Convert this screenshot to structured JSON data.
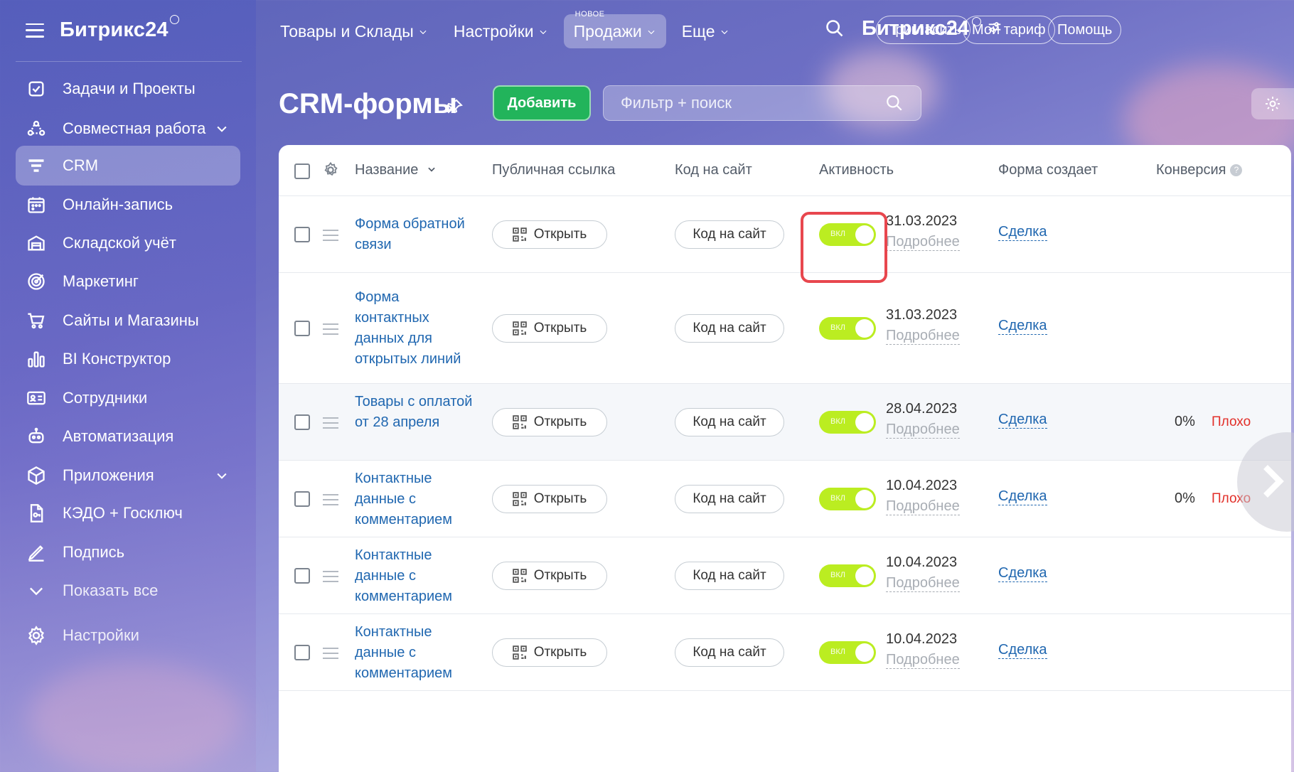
{
  "sidebar": {
    "logo": "Битрикс24",
    "items": [
      {
        "label": "Задачи и Проекты",
        "icon": "task-checkbox-icon"
      },
      {
        "label": "Совместная работа",
        "icon": "collaboration-icon",
        "expandable": true
      },
      {
        "label": "CRM",
        "icon": "crm-filter-icon",
        "active": true
      },
      {
        "label": "Онлайн-запись",
        "icon": "calendar-icon"
      },
      {
        "label": "Складской учёт",
        "icon": "warehouse-icon"
      },
      {
        "label": "Маркетинг",
        "icon": "target-icon"
      },
      {
        "label": "Сайты и Магазины",
        "icon": "cart-icon"
      },
      {
        "label": "BI Конструктор",
        "icon": "bar-chart-icon"
      },
      {
        "label": "Сотрудники",
        "icon": "id-card-icon"
      },
      {
        "label": "Автоматизация",
        "icon": "robot-icon"
      },
      {
        "label": "Приложения",
        "icon": "cube-icon",
        "expandable": true
      },
      {
        "label": "КЭДО + Госключ",
        "icon": "document-key-icon"
      },
      {
        "label": "Подпись",
        "icon": "signature-pen-icon"
      },
      {
        "label": "Показать все",
        "icon": "chevron-down-icon"
      },
      {
        "label": "Настройки",
        "icon": "gear-icon"
      }
    ]
  },
  "topnav": {
    "items": [
      {
        "label": "Товары и Склады"
      },
      {
        "label": "Настройки"
      },
      {
        "label": "Продажи",
        "badge": "НОВОЕ",
        "active": true
      },
      {
        "label": "Еще"
      }
    ],
    "logo": "Битрикс24",
    "invite": "Пригласить",
    "tariff": "Мой тариф",
    "help": "Помощь"
  },
  "page": {
    "title": "CRM-формы",
    "add_button": "Добавить",
    "filter_placeholder": "Фильтр + поиск"
  },
  "table": {
    "columns": [
      "Название",
      "Публичная ссылка",
      "Код на сайт",
      "Активность",
      "Форма создает",
      "Конверсия"
    ],
    "open_label": "Открыть",
    "code_label": "Код на сайт",
    "toggle_label": "ВКЛ",
    "more_label": "Подробнее",
    "rows": [
      {
        "name": "Форма обратной связи",
        "date": "31.03.2023",
        "creates": "Сделка",
        "conversion": "",
        "quality": ""
      },
      {
        "name": "Форма контактных данных для открытых линий",
        "date": "31.03.2023",
        "creates": "Сделка",
        "conversion": "",
        "quality": ""
      },
      {
        "name": "Товары с оплатой от 28 апреля",
        "date": "28.04.2023",
        "creates": "Сделка",
        "conversion": "0%",
        "quality": "Плохо"
      },
      {
        "name": "Контактные данные с комментарием",
        "date": "10.04.2023",
        "creates": "Сделка",
        "conversion": "0%",
        "quality": "Плохо"
      },
      {
        "name": "Контактные данные с комментарием",
        "date": "10.04.2023",
        "creates": "Сделка",
        "conversion": "",
        "quality": ""
      },
      {
        "name": "Контактные данные с комментарием",
        "date": "10.04.2023",
        "creates": "Сделка",
        "conversion": "",
        "quality": ""
      }
    ]
  },
  "colors": {
    "accent_green": "#22b45b",
    "toggle_on": "#bbed21",
    "link_blue": "#2067b0",
    "bad_red": "#e22f29",
    "highlight": "#e8474e"
  }
}
